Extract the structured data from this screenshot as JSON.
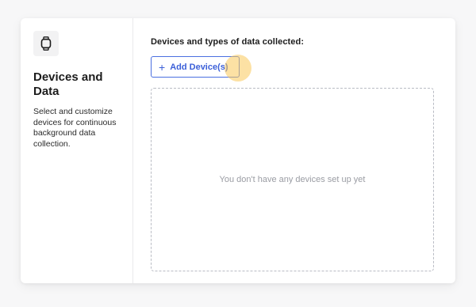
{
  "sidebar": {
    "icon": "smartwatch-icon",
    "title": "Devices and Data",
    "description": "Select and customize devices for continuous background data collection."
  },
  "main": {
    "heading": "Devices and types of data collected:",
    "add_button_label": "Add Device(s)",
    "empty_state_text": "You don't have any devices set up yet"
  },
  "colors": {
    "accent": "#3b5fd8",
    "highlight": "#fac85a"
  }
}
